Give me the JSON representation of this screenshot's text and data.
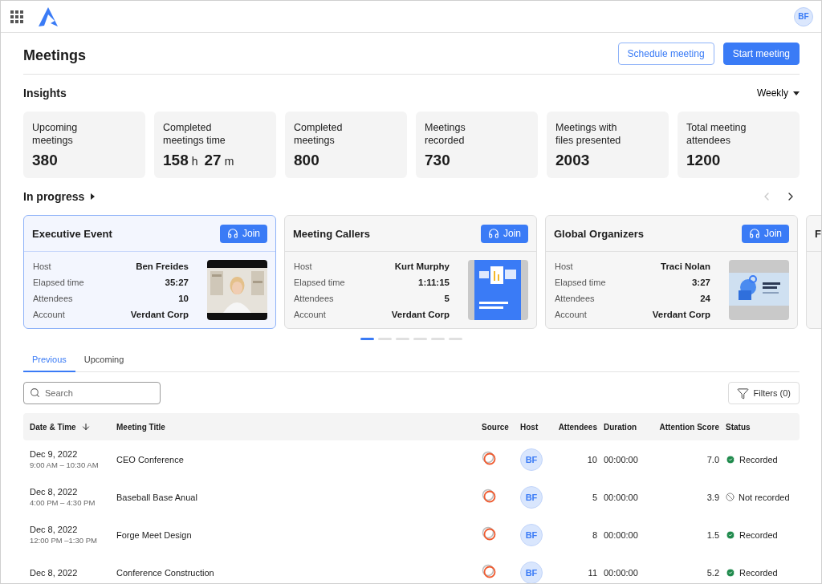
{
  "topbar": {
    "avatar": "BF"
  },
  "header": {
    "title": "Meetings",
    "buttons": [
      {
        "label": "Schedule meeting",
        "kind": "secondary"
      },
      {
        "label": "Start meeting",
        "kind": "primary"
      }
    ]
  },
  "insights": {
    "title": "Insights",
    "period": "Weekly",
    "cards": [
      {
        "label": "Upcoming meetings",
        "value": "380"
      },
      {
        "label": "Completed meetings time",
        "value": "158",
        "unit": "h",
        "value2": "27",
        "unit2": "m"
      },
      {
        "label": "Completed meetings",
        "value": "800"
      },
      {
        "label": "Meetings recorded",
        "value": "730"
      },
      {
        "label": "Meetings with files presented",
        "value": "2003"
      },
      {
        "label": "Total meeting attendees",
        "value": "1200"
      }
    ]
  },
  "in_progress": {
    "title": "In progress",
    "pager": {
      "prev_enabled": false,
      "next_enabled": true
    },
    "cards": [
      {
        "title": "Executive Event",
        "join": "Join",
        "selected": true,
        "fields": [
          {
            "label": "Host",
            "value": "Ben Freides"
          },
          {
            "label": "Elapsed time",
            "value": "35:27"
          },
          {
            "label": "Attendees",
            "value": "10"
          },
          {
            "label": "Account",
            "value": "Verdant Corp"
          }
        ]
      },
      {
        "title": "Meeting Callers",
        "join": "Join",
        "selected": false,
        "fields": [
          {
            "label": "Host",
            "value": "Kurt Murphy"
          },
          {
            "label": "Elapsed time",
            "value": "1:11:15"
          },
          {
            "label": "Attendees",
            "value": "5"
          },
          {
            "label": "Account",
            "value": "Verdant Corp"
          }
        ]
      },
      {
        "title": "Global Organizers",
        "join": "Join",
        "selected": false,
        "fields": [
          {
            "label": "Host",
            "value": "Traci Nolan"
          },
          {
            "label": "Elapsed time",
            "value": "3:27"
          },
          {
            "label": "Attendees",
            "value": "24"
          },
          {
            "label": "Account",
            "value": "Verdant Corp"
          }
        ]
      },
      {
        "title": "F",
        "selected": false
      }
    ],
    "pages": [
      {
        "selected": true
      },
      {
        "selected": false
      },
      {
        "selected": false
      },
      {
        "selected": false
      },
      {
        "selected": false
      },
      {
        "selected": false
      }
    ]
  },
  "tabs": [
    {
      "label": "Previous",
      "selected": true
    },
    {
      "label": "Upcoming",
      "selected": false
    }
  ],
  "search": {
    "placeholder": "Search"
  },
  "filters": {
    "label": "Filters (0)"
  },
  "table": {
    "columns": [
      {
        "label": "Date & Time",
        "sorted": true
      },
      {
        "label": "Meeting Title",
        "sorted": false
      },
      {
        "label": "Source",
        "sorted": false
      },
      {
        "label": "Host",
        "sorted": false
      },
      {
        "label": "Attendees",
        "sorted": false
      },
      {
        "label": "Duration",
        "sorted": false
      },
      {
        "label": "Attention Score",
        "sorted": false
      },
      {
        "label": "Status",
        "sorted": false
      }
    ],
    "rows": [
      {
        "date": "Dec 9, 2022",
        "time": "9:00 AM – 10:30 AM",
        "title": "CEO Conference",
        "host": "BF",
        "attendees": "10",
        "duration": "00:00:00",
        "score": "7.0",
        "status": "Recorded",
        "recorded": true
      },
      {
        "date": "Dec 8, 2022",
        "time": "4:00 PM – 4:30 PM",
        "title": "Baseball Base Anual",
        "host": "BF",
        "attendees": "5",
        "duration": "00:00:00",
        "score": "3.9",
        "status": "Not recorded",
        "recorded": false
      },
      {
        "date": "Dec 8, 2022",
        "time": "12:00 PM –1:30 PM",
        "title": "Forge Meet Design",
        "host": "BF",
        "attendees": "8",
        "duration": "00:00:00",
        "score": "1.5",
        "status": "Recorded",
        "recorded": true
      },
      {
        "date": "Dec 8, 2022",
        "title": "Conference Construction",
        "host": "BF",
        "attendees": "11",
        "duration": "00:00:00",
        "score": "5.2",
        "status": "Recorded",
        "recorded": true
      }
    ]
  }
}
